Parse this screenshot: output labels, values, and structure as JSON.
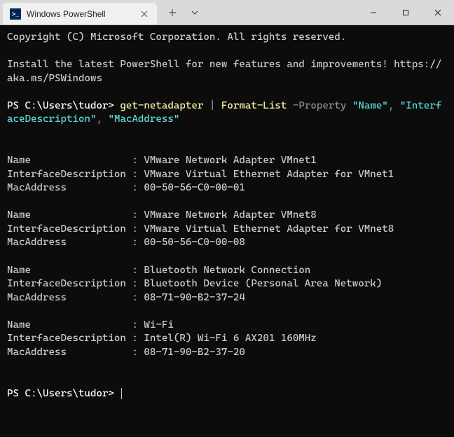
{
  "titlebar": {
    "tab_title": "Windows PowerShell",
    "tab_icon_text": ">_"
  },
  "terminal": {
    "copyright": "Copyright (C) Microsoft Corporation. All rights reserved.",
    "install_msg": "Install the latest PowerShell for new features and improvements! https://aka.ms/PSWindows",
    "prompt1_prefix": "PS C:\\Users\\tudor> ",
    "cmd_part1": "get-netadapter",
    "cmd_pipe": " | ",
    "cmd_part2": "Format-List",
    "cmd_flag": " -Property ",
    "cmd_arg1": "\"Name\"",
    "cmd_comma1": ", ",
    "cmd_arg2": "\"InterfaceDescription\"",
    "cmd_comma2": ", ",
    "cmd_arg3": "\"MacAddress\"",
    "adapters": [
      {
        "name_line": "Name                 : VMware Network Adapter VMnet1",
        "desc_line": "InterfaceDescription : VMware Virtual Ethernet Adapter for VMnet1",
        "mac_line": "MacAddress           : 00-50-56-C0-00-01"
      },
      {
        "name_line": "Name                 : VMware Network Adapter VMnet8",
        "desc_line": "InterfaceDescription : VMware Virtual Ethernet Adapter for VMnet8",
        "mac_line": "MacAddress           : 00-50-56-C0-00-08"
      },
      {
        "name_line": "Name                 : Bluetooth Network Connection",
        "desc_line": "InterfaceDescription : Bluetooth Device (Personal Area Network)",
        "mac_line": "MacAddress           : 08-71-90-B2-37-24"
      },
      {
        "name_line": "Name                 : Wi-Fi",
        "desc_line": "InterfaceDescription : Intel(R) Wi-Fi 6 AX201 160MHz",
        "mac_line": "MacAddress           : 08-71-90-B2-37-20"
      }
    ],
    "prompt2_prefix": "PS C:\\Users\\tudor> "
  }
}
